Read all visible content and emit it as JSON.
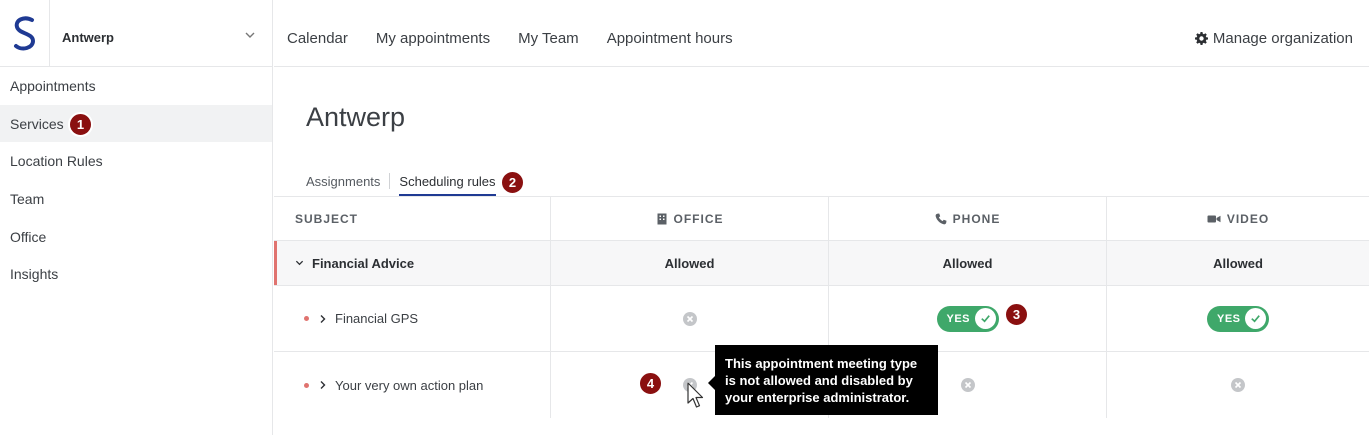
{
  "org": {
    "name": "Antwerp"
  },
  "sidebar": {
    "items": [
      {
        "label": "Appointments"
      },
      {
        "label": "Services"
      },
      {
        "label": "Location Rules"
      },
      {
        "label": "Team"
      },
      {
        "label": "Office"
      },
      {
        "label": "Insights"
      }
    ]
  },
  "topnav": {
    "items": [
      {
        "label": "Calendar"
      },
      {
        "label": "My appointments"
      },
      {
        "label": "My Team"
      },
      {
        "label": "Appointment hours"
      }
    ],
    "manage_label": "Manage organization"
  },
  "page": {
    "title": "Antwerp"
  },
  "subtabs": [
    {
      "label": "Assignments"
    },
    {
      "label": "Scheduling rules"
    }
  ],
  "table": {
    "headers": {
      "subject": "SUBJECT",
      "office": "OFFICE",
      "phone": "PHONE",
      "video": "VIDEO"
    },
    "group": {
      "label": "Financial Advice",
      "office": "Allowed",
      "phone": "Allowed",
      "video": "Allowed"
    },
    "rows": [
      {
        "label": "Financial GPS",
        "toggle_label": "YES"
      },
      {
        "label": "Your very own action plan"
      }
    ]
  },
  "tooltip": {
    "text": "This appointment meeting type is not allowed and disabled by your enterprise administrator."
  },
  "badges": [
    "1",
    "2",
    "3",
    "4"
  ],
  "colors": {
    "brand": "#1f3a93",
    "toggle_on": "#3fa86a",
    "badge": "#8a1010",
    "accent": "#e0736f"
  },
  "icons": {
    "office": "building-icon",
    "phone": "phone-icon",
    "video": "video-camera-icon",
    "manage": "gear-icon"
  }
}
